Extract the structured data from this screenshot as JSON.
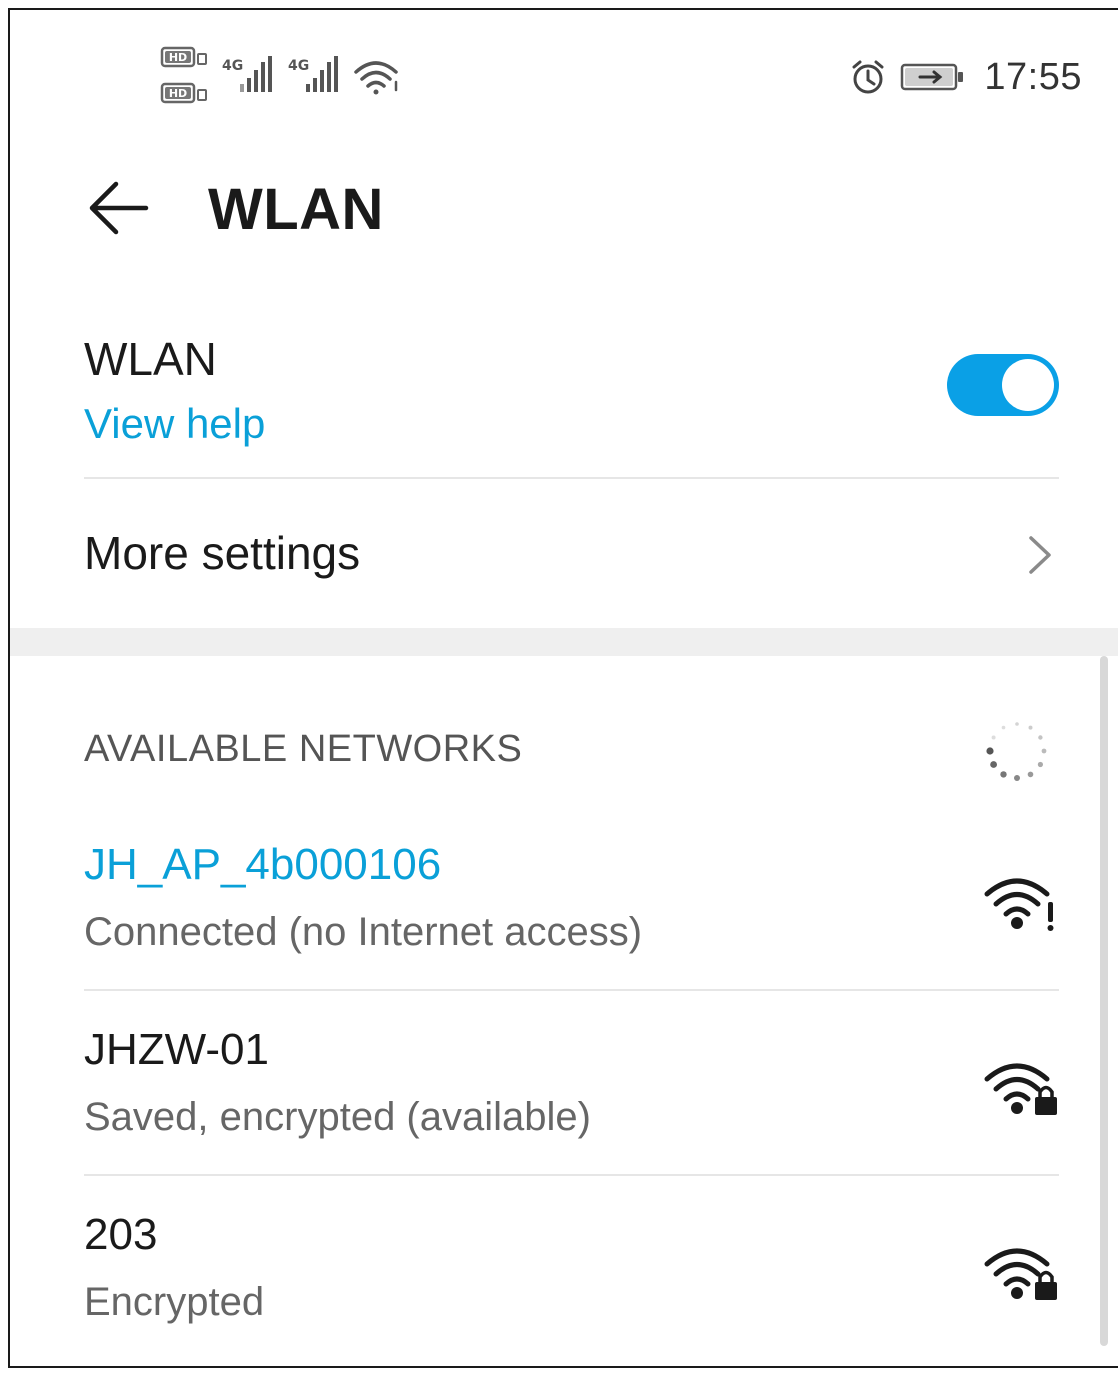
{
  "status_bar": {
    "time": "17:55",
    "hd_label": "HD",
    "network_type": "4G",
    "icons": [
      "hd-icon",
      "signal-4g-icon",
      "wifi-icon",
      "alarm-icon",
      "battery-charging-icon"
    ]
  },
  "header": {
    "title": "WLAN",
    "back_icon": "back-arrow-icon"
  },
  "wlan_toggle": {
    "label": "WLAN",
    "help_link": "View help",
    "enabled": true
  },
  "more_settings": {
    "label": "More settings",
    "icon": "chevron-right-icon"
  },
  "networks_section": {
    "header": "AVAILABLE NETWORKS",
    "icon": "scanning-spinner-icon"
  },
  "networks": [
    {
      "name": "JH_AP_4b000106",
      "status": "Connected (no Internet access)",
      "connected": true,
      "icon": "wifi-no-internet-icon"
    },
    {
      "name": "JHZW-01",
      "status": "Saved, encrypted (available)",
      "connected": false,
      "icon": "wifi-locked-icon"
    },
    {
      "name": "203",
      "status": "Encrypted",
      "connected": false,
      "icon": "wifi-locked-icon"
    }
  ],
  "colors": {
    "accent": "#0aa0d8",
    "toggle_on": "#0aa0e6",
    "text_primary": "#1a1a1a",
    "text_secondary": "#666666"
  }
}
